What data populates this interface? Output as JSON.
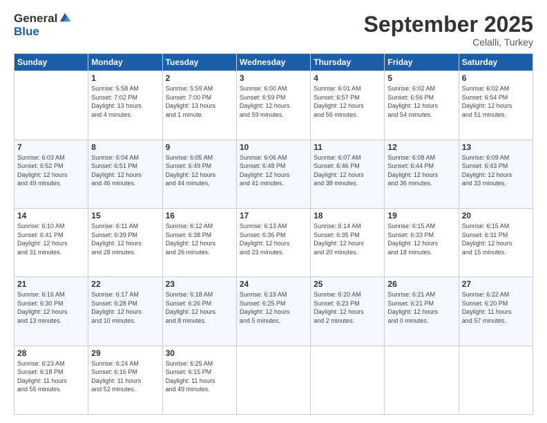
{
  "header": {
    "logo_line1": "General",
    "logo_line2": "Blue",
    "month_title": "September 2025",
    "location": "Celalli, Turkey"
  },
  "days_of_week": [
    "Sunday",
    "Monday",
    "Tuesday",
    "Wednesday",
    "Thursday",
    "Friday",
    "Saturday"
  ],
  "weeks": [
    [
      {
        "day": "",
        "info": ""
      },
      {
        "day": "1",
        "info": "Sunrise: 5:58 AM\nSunset: 7:02 PM\nDaylight: 13 hours\nand 4 minutes."
      },
      {
        "day": "2",
        "info": "Sunrise: 5:59 AM\nSunset: 7:00 PM\nDaylight: 13 hours\nand 1 minute."
      },
      {
        "day": "3",
        "info": "Sunrise: 6:00 AM\nSunset: 6:59 PM\nDaylight: 12 hours\nand 59 minutes."
      },
      {
        "day": "4",
        "info": "Sunrise: 6:01 AM\nSunset: 6:57 PM\nDaylight: 12 hours\nand 56 minutes."
      },
      {
        "day": "5",
        "info": "Sunrise: 6:02 AM\nSunset: 6:56 PM\nDaylight: 12 hours\nand 54 minutes."
      },
      {
        "day": "6",
        "info": "Sunrise: 6:02 AM\nSunset: 6:54 PM\nDaylight: 12 hours\nand 51 minutes."
      }
    ],
    [
      {
        "day": "7",
        "info": "Sunrise: 6:03 AM\nSunset: 6:52 PM\nDaylight: 12 hours\nand 49 minutes."
      },
      {
        "day": "8",
        "info": "Sunrise: 6:04 AM\nSunset: 6:51 PM\nDaylight: 12 hours\nand 46 minutes."
      },
      {
        "day": "9",
        "info": "Sunrise: 6:05 AM\nSunset: 6:49 PM\nDaylight: 12 hours\nand 44 minutes."
      },
      {
        "day": "10",
        "info": "Sunrise: 6:06 AM\nSunset: 6:48 PM\nDaylight: 12 hours\nand 41 minutes."
      },
      {
        "day": "11",
        "info": "Sunrise: 6:07 AM\nSunset: 6:46 PM\nDaylight: 12 hours\nand 38 minutes."
      },
      {
        "day": "12",
        "info": "Sunrise: 6:08 AM\nSunset: 6:44 PM\nDaylight: 12 hours\nand 36 minutes."
      },
      {
        "day": "13",
        "info": "Sunrise: 6:09 AM\nSunset: 6:43 PM\nDaylight: 12 hours\nand 33 minutes."
      }
    ],
    [
      {
        "day": "14",
        "info": "Sunrise: 6:10 AM\nSunset: 6:41 PM\nDaylight: 12 hours\nand 31 minutes."
      },
      {
        "day": "15",
        "info": "Sunrise: 6:11 AM\nSunset: 6:39 PM\nDaylight: 12 hours\nand 28 minutes."
      },
      {
        "day": "16",
        "info": "Sunrise: 6:12 AM\nSunset: 6:38 PM\nDaylight: 12 hours\nand 26 minutes."
      },
      {
        "day": "17",
        "info": "Sunrise: 6:13 AM\nSunset: 6:36 PM\nDaylight: 12 hours\nand 23 minutes."
      },
      {
        "day": "18",
        "info": "Sunrise: 6:14 AM\nSunset: 6:35 PM\nDaylight: 12 hours\nand 20 minutes."
      },
      {
        "day": "19",
        "info": "Sunrise: 6:15 AM\nSunset: 6:33 PM\nDaylight: 12 hours\nand 18 minutes."
      },
      {
        "day": "20",
        "info": "Sunrise: 6:15 AM\nSunset: 6:31 PM\nDaylight: 12 hours\nand 15 minutes."
      }
    ],
    [
      {
        "day": "21",
        "info": "Sunrise: 6:16 AM\nSunset: 6:30 PM\nDaylight: 12 hours\nand 13 minutes."
      },
      {
        "day": "22",
        "info": "Sunrise: 6:17 AM\nSunset: 6:28 PM\nDaylight: 12 hours\nand 10 minutes."
      },
      {
        "day": "23",
        "info": "Sunrise: 6:18 AM\nSunset: 6:26 PM\nDaylight: 12 hours\nand 8 minutes."
      },
      {
        "day": "24",
        "info": "Sunrise: 6:19 AM\nSunset: 6:25 PM\nDaylight: 12 hours\nand 5 minutes."
      },
      {
        "day": "25",
        "info": "Sunrise: 6:20 AM\nSunset: 6:23 PM\nDaylight: 12 hours\nand 2 minutes."
      },
      {
        "day": "26",
        "info": "Sunrise: 6:21 AM\nSunset: 6:21 PM\nDaylight: 12 hours\nand 0 minutes."
      },
      {
        "day": "27",
        "info": "Sunrise: 6:22 AM\nSunset: 6:20 PM\nDaylight: 11 hours\nand 57 minutes."
      }
    ],
    [
      {
        "day": "28",
        "info": "Sunrise: 6:23 AM\nSunset: 6:18 PM\nDaylight: 11 hours\nand 55 minutes."
      },
      {
        "day": "29",
        "info": "Sunrise: 6:24 AM\nSunset: 6:16 PM\nDaylight: 11 hours\nand 52 minutes."
      },
      {
        "day": "30",
        "info": "Sunrise: 6:25 AM\nSunset: 6:15 PM\nDaylight: 11 hours\nand 49 minutes."
      },
      {
        "day": "",
        "info": ""
      },
      {
        "day": "",
        "info": ""
      },
      {
        "day": "",
        "info": ""
      },
      {
        "day": "",
        "info": ""
      }
    ]
  ]
}
